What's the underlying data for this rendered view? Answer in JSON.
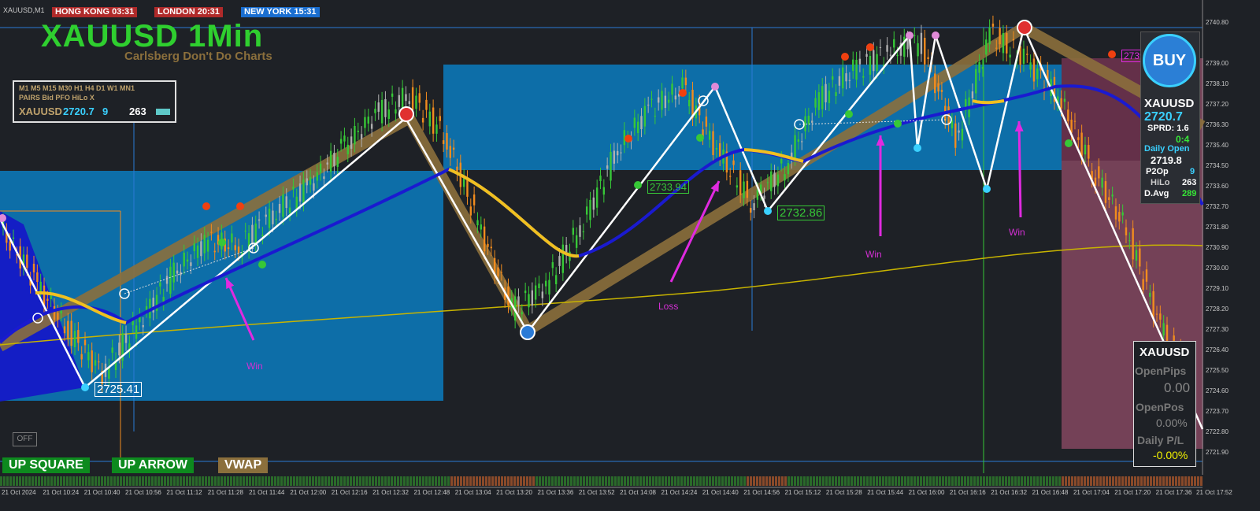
{
  "window": {
    "symbol_tab": "XAUUSD,M1"
  },
  "sessions": [
    {
      "label": "HONG KONG 03:31",
      "color": "#b02a2a"
    },
    {
      "label": "LONDON  20:31",
      "color": "#b02a2a"
    },
    {
      "label": "NEW YORK 15:31",
      "color": "#1a6ed0"
    }
  ],
  "header": {
    "title": "XAUUSD 1Min",
    "subtitle": "Carlsberg Don't Do Charts"
  },
  "tf_panel": {
    "timeframes": [
      "M1",
      "M5",
      "M15",
      "M30",
      "H1",
      "H4",
      "D1",
      "W1",
      "MN1"
    ],
    "col_labels": [
      "PAIRS",
      "Bid",
      "PFO",
      "HiLo",
      "X"
    ],
    "pair": "XAUUSD",
    "bid": "2720.7",
    "pfo": "9",
    "hilo": "263"
  },
  "buttons": {
    "off": "OFF",
    "up_square": "UP SQUARE",
    "up_arrow": "UP ARROW",
    "vwap": "VWAP"
  },
  "buy_panel": {
    "buy_label": "BUY",
    "symbol": "XAUUSD",
    "price": "2720.7",
    "spread_label": "SPRD: 1.6",
    "ratio": "0:4",
    "daily_open_label": "Daily Open",
    "daily_open": "2719.8",
    "p2op_label": "P2Op",
    "p2op": "9",
    "hilo_label": "HiLo",
    "hilo": "263",
    "davg_label": "D.Avg",
    "davg": "289"
  },
  "pos_panel": {
    "symbol": "XAUUSD",
    "open_pips_label": "OpenPips",
    "open_pips": "0.00",
    "open_pos_label": "OpenPos",
    "open_pos": "0.00%",
    "daily_pl_label": "Daily P/L",
    "daily_pl": "-0.00%"
  },
  "price_labels": {
    "low1": "2725.41",
    "mid": "2733.94",
    "low2": "2732.86",
    "top": "2739.48"
  },
  "annotations": {
    "win1": "Win",
    "loss": "Loss",
    "win2": "Win",
    "win3": "Win"
  },
  "colors": {
    "bg": "#1e2126",
    "box": "#0d6ea8",
    "green": "#37c837",
    "orange": "#f28c1e",
    "white": "#ffffff",
    "navy": "#1515c8",
    "yellow": "#f0c020",
    "tan": "#8b6f3c",
    "magenta": "#e02ae0"
  },
  "chart_data": {
    "type": "line",
    "title": "XAUUSD 1Min",
    "ylim": [
      2721.0,
      2740.8
    ],
    "y_ticks": [
      "2740.80",
      "2739.00",
      "2738.10",
      "2737.20",
      "2736.30",
      "2735.40",
      "2734.50",
      "2733.60",
      "2732.70",
      "2731.80",
      "2730.90",
      "2730.00",
      "2729.10",
      "2728.20",
      "2727.30",
      "2726.40",
      "2725.50",
      "2724.60",
      "2723.70",
      "2722.80",
      "2721.90"
    ],
    "x_ticks": [
      "21 Oct 2024",
      "21 Oct 10:24",
      "21 Oct 10:40",
      "21 Oct 10:56",
      "21 Oct 11:12",
      "21 Oct 11:28",
      "21 Oct 11:44",
      "21 Oct 12:00",
      "21 Oct 12:16",
      "21 Oct 12:32",
      "21 Oct 12:48",
      "21 Oct 13:04",
      "21 Oct 13:20",
      "21 Oct 13:36",
      "21 Oct 13:52",
      "21 Oct 14:08",
      "21 Oct 14:24",
      "21 Oct 14:40",
      "21 Oct 14:56",
      "21 Oct 15:12",
      "21 Oct 15:28",
      "21 Oct 15:44",
      "21 Oct 16:00",
      "21 Oct 16:16",
      "21 Oct 16:32",
      "21 Oct 16:48",
      "21 Oct 17:04",
      "21 Oct 17:20",
      "21 Oct 17:36",
      "21 Oct 17:52"
    ],
    "series": [
      {
        "name": "price",
        "values": [
          2731.8,
          2729.5,
          2727.2,
          2725.4,
          2727.5,
          2729.6,
          2731.2,
          2731.0,
          2732.4,
          2733.6,
          2735.2,
          2736.8,
          2737.6,
          2735.9,
          2732.0,
          2728.2,
          2729.3,
          2731.8,
          2735.0,
          2737.0,
          2737.9,
          2735.2,
          2732.9,
          2734.5,
          2737.5,
          2738.7,
          2739.5,
          2739.9,
          2735.6,
          2740.3,
          2739.2,
          2737.6,
          2734.4,
          2731.7,
          2727.4,
          2724.7
        ]
      }
    ]
  }
}
